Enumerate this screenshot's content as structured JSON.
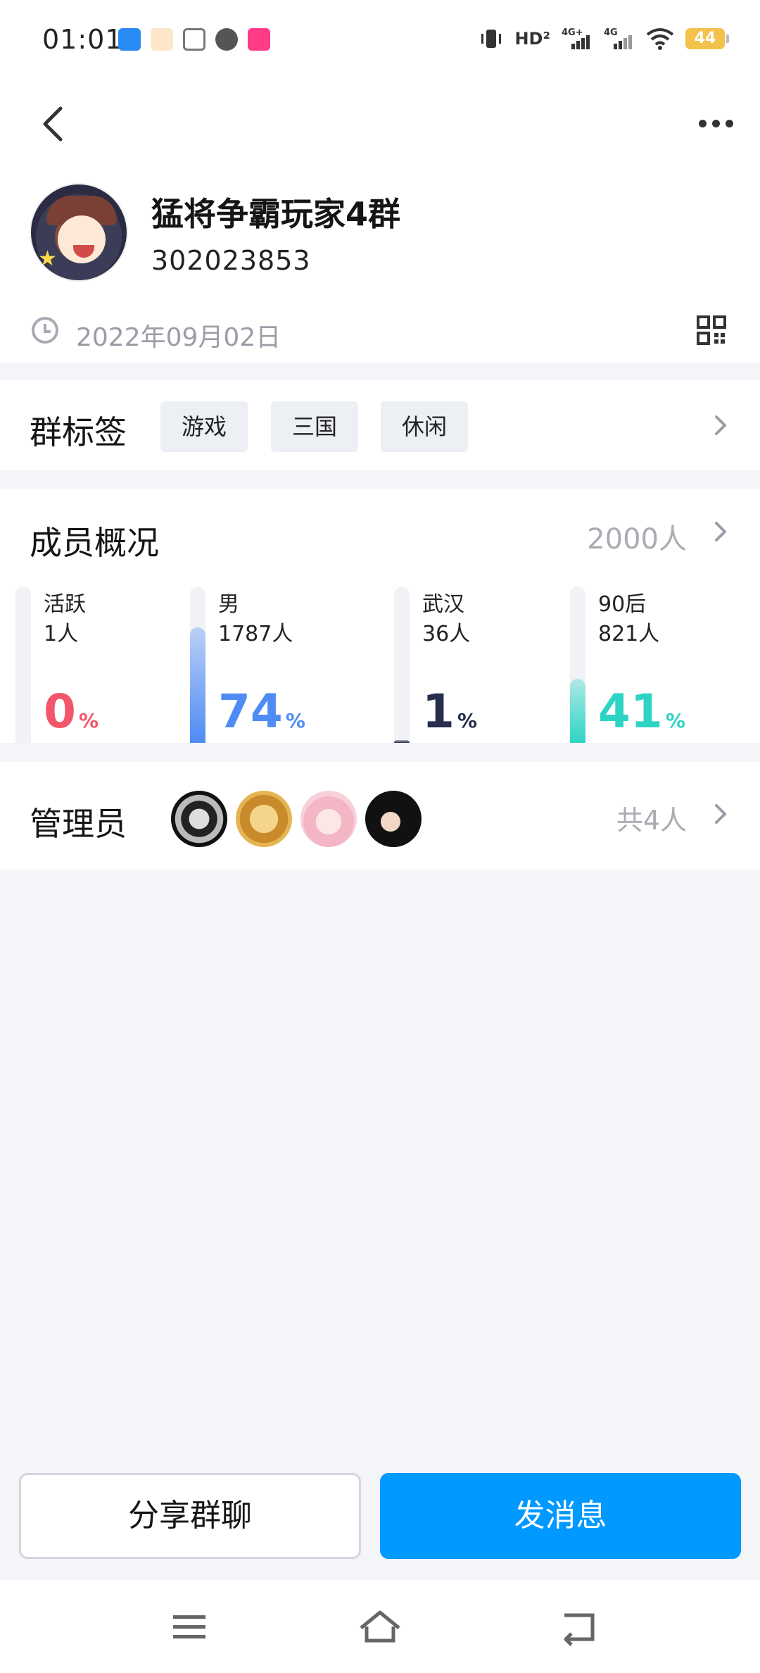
{
  "status_bar": {
    "time": "01:01",
    "battery": "44",
    "indicators": [
      "vibrate-icon",
      "hd-icon",
      "4g-plus-signal-icon",
      "4g-signal-icon",
      "wifi-icon",
      "battery-icon"
    ],
    "app_icons": [
      "gallery-app-icon",
      "pinduoduo-app-icon",
      "document-app-icon",
      "speed-app-icon",
      "meitu-app-icon"
    ]
  },
  "group": {
    "name": "猛将争霸玩家4群",
    "id": "302023853",
    "created_date": "2022年09月02日"
  },
  "tags": {
    "title": "群标签",
    "items": [
      "游戏",
      "三国",
      "休闲"
    ]
  },
  "members": {
    "title": "成员概况",
    "total": "2000人",
    "stats": [
      {
        "label": "活跃",
        "count": "1人",
        "percent": "0",
        "percent_value": 0,
        "color": "#f2566a"
      },
      {
        "label": "男",
        "count": "1787人",
        "percent": "74",
        "percent_value": 74,
        "color": "#4e8bf5"
      },
      {
        "label": "武汉",
        "count": "36人",
        "percent": "1",
        "percent_value": 1,
        "color": "#262d4d"
      },
      {
        "label": "90后",
        "count": "821人",
        "percent": "41",
        "percent_value": 41,
        "color": "#2dd4c4"
      }
    ],
    "percent_unit": "%"
  },
  "admins": {
    "title": "管理员",
    "count": "共4人",
    "avatars": [
      "admin-avatar-manga",
      "admin-avatar-golden",
      "admin-avatar-pink-anime",
      "admin-avatar-girl-photo"
    ]
  },
  "buttons": {
    "share": "分享群聊",
    "send": "发消息"
  },
  "colors": {
    "primary": "#0099ff",
    "page_bg": "#f4f5f9",
    "muted_text": "#a9acb3"
  }
}
